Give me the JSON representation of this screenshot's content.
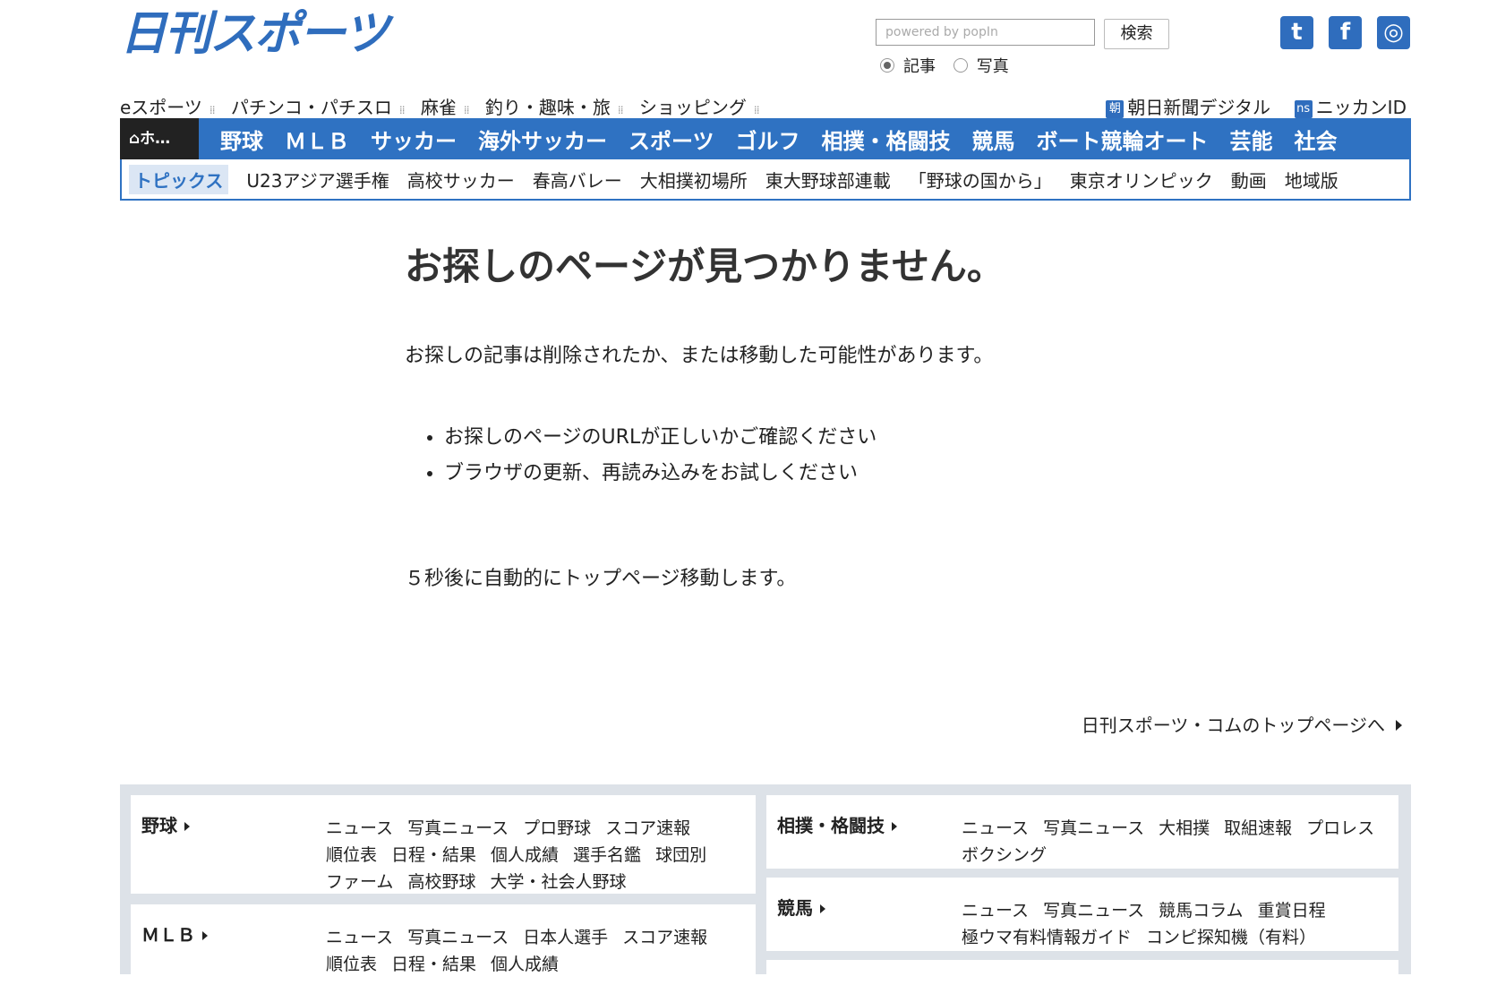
{
  "header": {
    "logo": "日刊スポーツ",
    "search_placeholder": "powered by popIn",
    "search_button": "検索",
    "radio_article": "記事",
    "radio_photo": "写真",
    "social": {
      "twitter": "t",
      "facebook": "f",
      "instagram": "◎"
    }
  },
  "top_nav": {
    "items": [
      "eスポーツ",
      "パチンコ・パチスロ",
      "麻雀",
      "釣り・趣味・旅",
      "ショッピング"
    ],
    "asahi_icon": "朝",
    "asahi": "朝日新聞デジタル",
    "nikkan_icon": "ns",
    "nikkan": "ニッカンID"
  },
  "main_nav": {
    "home": "ホ…",
    "items": [
      "野球",
      "ＭＬＢ",
      "サッカー",
      "海外サッカー",
      "スポーツ",
      "ゴルフ",
      "相撲・格闘技",
      "競馬",
      "ボート競輪オート",
      "芸能",
      "社会"
    ]
  },
  "sub_nav": {
    "tag": "トピックス",
    "items": [
      "U23アジア選手権",
      "高校サッカー",
      "春高バレー",
      "大相撲初場所",
      "東大野球部連載",
      "「野球の国から」",
      "東京オリンピック",
      "動画",
      "地域版"
    ]
  },
  "content": {
    "title": "お探しのページが見つかりません。",
    "message": "お探しの記事は削除されたか、または移動した可能性があります。",
    "bullets": [
      "お探しのページのURLが正しいかご確認ください",
      "ブラウザの更新、再読み込みをお試しください"
    ],
    "redirect": "５秒後に自動的にトップページ移動します。",
    "toplink": "日刊スポーツ・コムのトップページへ"
  },
  "sitemap": {
    "baseball": {
      "title": "野球",
      "links": [
        [
          "ニュース",
          "写真ニュース",
          "プロ野球",
          "スコア速報"
        ],
        [
          "順位表",
          "日程・結果",
          "個人成績",
          "選手名鑑",
          "球団別"
        ],
        [
          "ファーム",
          "高校野球",
          "大学・社会人野球"
        ]
      ]
    },
    "mlb": {
      "title": "ＭＬＢ",
      "links": [
        [
          "ニュース",
          "写真ニュース",
          "日本人選手",
          "スコア速報"
        ],
        [
          "順位表",
          "日程・結果",
          "個人成績"
        ]
      ]
    },
    "sumo": {
      "title": "相撲・格闘技",
      "links": [
        [
          "ニュース",
          "写真ニュース",
          "大相撲",
          "取組速報",
          "プロレス"
        ],
        [
          "ボクシング"
        ]
      ]
    },
    "keiba": {
      "title": "競馬",
      "links": [
        [
          "ニュース",
          "写真ニュース",
          "競馬コラム",
          "重賞日程"
        ],
        [
          "極ウマ有料情報ガイド",
          "コンピ探知機（有料）"
        ]
      ]
    }
  }
}
